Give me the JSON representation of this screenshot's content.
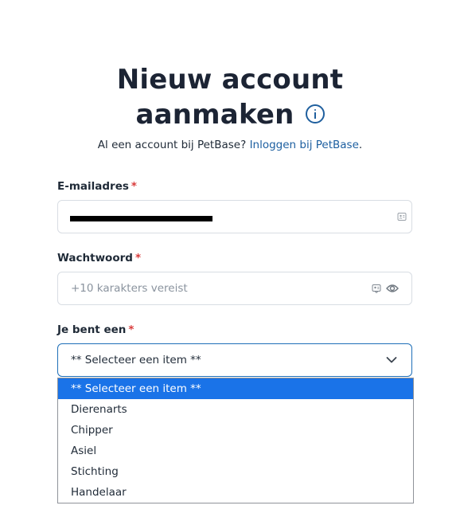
{
  "header": {
    "title_line1": "Nieuw account",
    "title_line2": "aanmaken",
    "subline_text": "Al een account bij PetBase?",
    "login_link": "Inloggen bij PetBase",
    "subline_end": "."
  },
  "form": {
    "email": {
      "label": "E-mailadres",
      "required_mark": "*"
    },
    "password": {
      "label": "Wachtwoord",
      "required_mark": "*",
      "placeholder": "+10 karakters vereist"
    },
    "role": {
      "label": "Je bent een",
      "required_mark": "*",
      "selected": "** Selecteer een item **",
      "options": [
        "** Selecteer een item **",
        "Dierenarts",
        "Chipper",
        "Asiel",
        "Stichting",
        "Handelaar"
      ]
    }
  },
  "colors": {
    "accent": "#1d5fa0",
    "required": "#d93b3b",
    "selected_option": "#1a73e8"
  }
}
